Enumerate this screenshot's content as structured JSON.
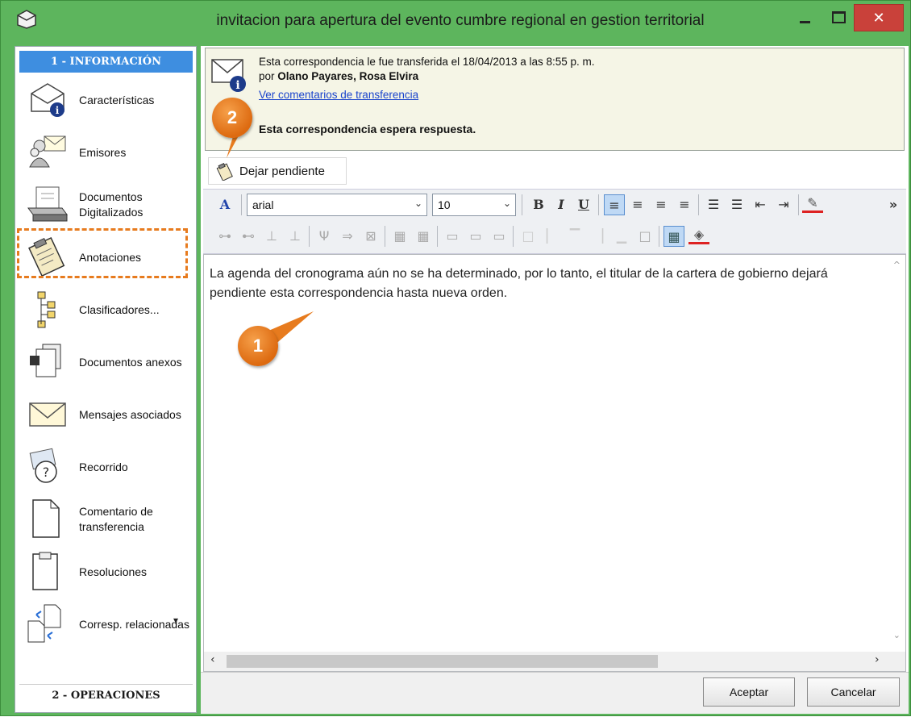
{
  "window": {
    "title": "invitacion para apertura del evento cumbre regional en gestion territorial",
    "minimize_icon": "minimize-icon",
    "maximize_icon": "maximize-icon",
    "close_glyph": "✕",
    "accent_color": "#5db55d",
    "close_color": "#c9413a"
  },
  "sidebar": {
    "section1_label": "1 - INFORMACIÓN",
    "section2_label": "2 - OPERACIONES",
    "items": [
      {
        "label": "Características",
        "icon": "envelope-info-icon"
      },
      {
        "label": "Emisores",
        "icon": "senders-icon"
      },
      {
        "label": "Documentos Digitalizados",
        "icon": "scanner-icon"
      },
      {
        "label": "Anotaciones",
        "icon": "clipboard-icon"
      },
      {
        "label": "Clasificadores...",
        "icon": "tree-icon"
      },
      {
        "label": "Documentos anexos",
        "icon": "attached-documents-icon"
      },
      {
        "label": "Mensajes asociados",
        "icon": "envelope-icon"
      },
      {
        "label": "Recorrido",
        "icon": "route-icon"
      },
      {
        "label": "Comentario de transferencia",
        "icon": "blank-page-icon"
      },
      {
        "label": "Resoluciones",
        "icon": "page-stamp-icon"
      },
      {
        "label": "Corresp. relacionadas",
        "icon": "related-pages-icon"
      }
    ],
    "dropdown_glyph": "▾"
  },
  "notice": {
    "line1": "Esta correspondencia le fue transferida el 18/04/2013 a las 8:55 p. m.",
    "line2_prefix": "por ",
    "line2_name": "Olano Payares, Rosa Elvira",
    "link": "Ver comentarios de transferencia",
    "wait": "Esta correspondencia espera respuesta."
  },
  "pending_button": {
    "label": "Dejar pendiente"
  },
  "toolbar": {
    "font_value": "arial",
    "size_value": "10",
    "bold": "B",
    "italic": "I",
    "underline": "U",
    "more": "»"
  },
  "editor": {
    "text": "La agenda del cronograma aún no se ha determinado, por lo tanto, el titular de la cartera de gobierno dejará pendiente esta correspondencia hasta nueva orden."
  },
  "footer": {
    "ok_label": "Aceptar",
    "cancel_label": "Cancelar"
  },
  "callouts": [
    {
      "number": "1",
      "color": "#e77b1e"
    },
    {
      "number": "2",
      "color": "#e77b1e"
    }
  ]
}
